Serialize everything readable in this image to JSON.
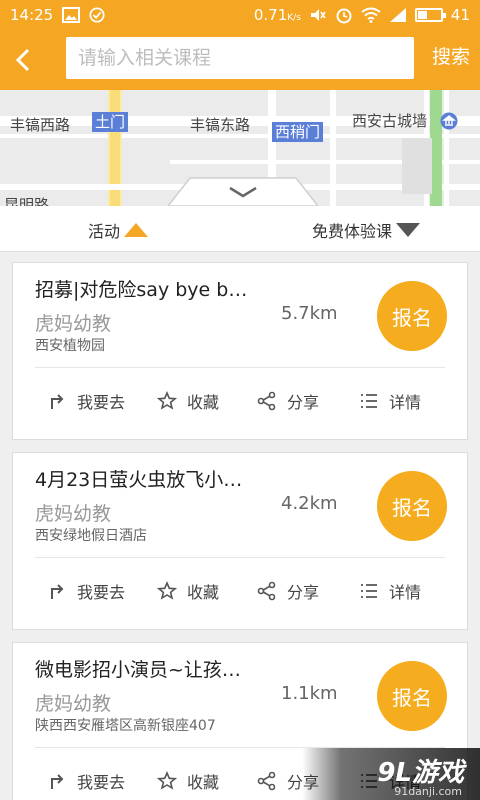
{
  "status_bar": {
    "time": "14:25",
    "network_speed": "0.71",
    "network_unit": "K/s",
    "battery_level": "41",
    "battery_fraction": 0.41
  },
  "header": {
    "search_placeholder": "请输入相关课程",
    "search_label": "搜索"
  },
  "map": {
    "labels": [
      "丰镐西路",
      "土门",
      "丰镐东路",
      "西稍门",
      "西安古城墙",
      "昆明路"
    ]
  },
  "filter": {
    "left_label": "活动",
    "right_label": "免费体验课"
  },
  "cards": [
    {
      "title": "招募|对危险say bye b…",
      "org": "虎妈幼教",
      "address": "西安植物园",
      "distance": "5.7km",
      "signup": "报名",
      "actions": [
        "我要去",
        "收藏",
        "分享",
        "详情"
      ]
    },
    {
      "title": "4月23日萤火虫放飞小…",
      "org": "虎妈幼教",
      "address": "西安绿地假日酒店",
      "distance": "4.2km",
      "signup": "报名",
      "actions": [
        "我要去",
        "收藏",
        "分享",
        "详情"
      ]
    },
    {
      "title": "微电影招小演员~让孩…",
      "org": "虎妈幼教",
      "address": "陕西西安雁塔区高新银座407",
      "distance": "1.1km",
      "signup": "报名",
      "actions": [
        "我要去",
        "收藏",
        "分享",
        "详情"
      ]
    }
  ],
  "watermark": {
    "main": "9L游戏",
    "sub": "91danji.com"
  },
  "colors": {
    "brand": "#f5a623",
    "metro": "#5b7fd6"
  }
}
